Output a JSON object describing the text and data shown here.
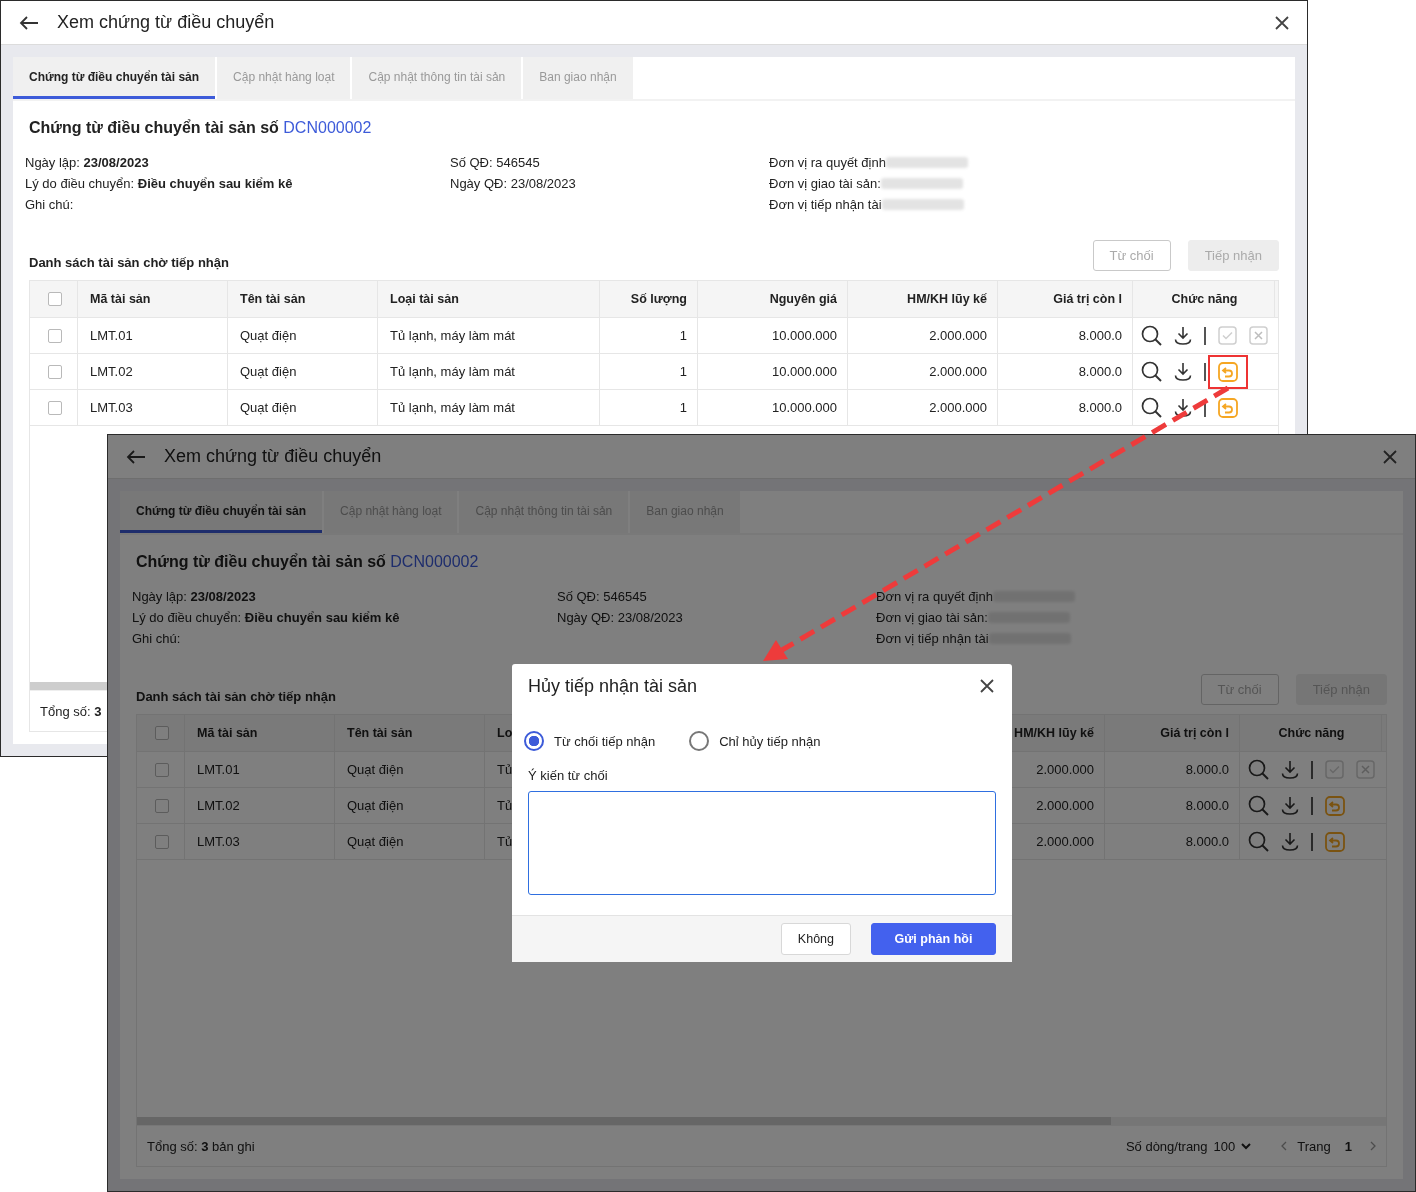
{
  "windows": [
    {
      "title": "Xem chứng từ điều chuyển",
      "dimmed": false,
      "tabs": [
        {
          "label": "Chứng từ điều chuyển tài sản",
          "selected": true
        },
        {
          "label": "Cập nhật hàng loạt",
          "selected": false
        },
        {
          "label": "Cập nhật thông tin tài sản",
          "selected": false
        },
        {
          "label": "Ban giao nhận",
          "selected": false
        }
      ],
      "heading": {
        "text": "Chứng từ điều chuyển tài sản số",
        "number": "DCN000002"
      },
      "details": [
        [
          {
            "label": "Ngày lập:",
            "value": "23/08/2023",
            "bold": true
          },
          {
            "label": "Lý do điều chuyển:",
            "value": "Điều chuyển sau kiểm kê",
            "bold": true
          },
          {
            "label": "Ghi chú:"
          }
        ],
        [
          {
            "label": "Số QĐ:",
            "value": "546545",
            "bold": false
          },
          {
            "label": "Ngày QĐ:",
            "value": "23/08/2023",
            "bold": false
          }
        ],
        [
          {
            "label": "Đơn vị ra quyết định",
            "blurred": true
          },
          {
            "label": "Đơn vị giao tài sản:",
            "blurred": true
          },
          {
            "label": "Đơn vị tiếp nhận tài",
            "blurred": true
          }
        ]
      ],
      "list_title": "Danh sách tài sản chờ tiếp nhận",
      "buttons": [
        {
          "label": "Từ chối",
          "kind": "outline",
          "disabled": true
        },
        {
          "label": "Tiếp nhận",
          "kind": "filled",
          "disabled": true
        }
      ],
      "table": {
        "select_all_checked": false,
        "columns": {
          "code": "Mã tài sản",
          "name": "Tên tài sản",
          "type": "Loại tài sản",
          "quantity": "Số lượng",
          "cost": "Nguyên giá",
          "depreciation": "HM/KH lũy kế",
          "remaining": "Giá trị còn l",
          "actions": "Chức năng"
        },
        "rows": [
          {
            "checked": false,
            "highlighted": false,
            "cells": {
              "code": "LMT.01",
              "name": "Quạt điện",
              "type": "Tủ lạnh, máy làm mát",
              "quantity": "1",
              "cost": "10.000.000",
              "depreciation": "2.000.000",
              "remaining": "8.000.0"
            },
            "actions": [
              {
                "kind": "search"
              },
              {
                "kind": "download"
              },
              {
                "kind": "accept"
              },
              {
                "kind": "reject"
              }
            ]
          },
          {
            "checked": false,
            "highlighted": true,
            "cells": {
              "code": "LMT.02",
              "name": "Quạt điện",
              "type": "Tủ lạnh, máy làm mát",
              "quantity": "1",
              "cost": "10.000.000",
              "depreciation": "2.000.000",
              "remaining": "8.000.0"
            },
            "actions": [
              {
                "kind": "search"
              },
              {
                "kind": "download"
              },
              {
                "kind": "return"
              }
            ]
          },
          {
            "checked": false,
            "highlighted": false,
            "cells": {
              "code": "LMT.03",
              "name": "Quạt điện",
              "type": "Tủ lạnh, máy làm mát",
              "quantity": "1",
              "cost": "10.000.000",
              "depreciation": "2.000.000",
              "remaining": "8.000.0"
            },
            "actions": [
              {
                "kind": "search"
              },
              {
                "kind": "download"
              },
              {
                "kind": "return"
              }
            ]
          }
        ]
      },
      "footer": {
        "total": "Tổng số: **3**"
      }
    },
    {
      "title": "Xem chứng từ điều chuyển",
      "dimmed": true,
      "tabs": [
        {
          "label": "Chứng từ điều chuyển tài sản",
          "selected": true
        },
        {
          "label": "Cập nhật hàng loạt",
          "selected": false
        },
        {
          "label": "Cập nhật thông tin tài sản",
          "selected": false
        },
        {
          "label": "Ban giao nhận",
          "selected": false
        }
      ],
      "heading": {
        "text": "Chứng từ điều chuyển tài sản số",
        "number": "DCN000002"
      },
      "details": [
        [
          {
            "label": "Ngày lập:",
            "value": "23/08/2023",
            "bold": true
          },
          {
            "label": "Lý do điều chuyển:",
            "value": "Điều chuyển sau kiểm kê",
            "bold": true
          },
          {
            "label": "Ghi chú:"
          }
        ],
        [
          {
            "label": "Số QĐ:",
            "value": "546545",
            "bold": false
          },
          {
            "label": "Ngày QĐ:",
            "value": "23/08/2023",
            "bold": false
          }
        ],
        [
          {
            "label": "Đơn vị ra quyết định",
            "blurred": true
          },
          {
            "label": "Đơn vị giao tài sản:",
            "blurred": true
          },
          {
            "label": "Đơn vị tiếp nhận tài",
            "blurred": true
          }
        ]
      ],
      "list_title": "Danh sách tài sản chờ tiếp nhận",
      "buttons": [
        {
          "label": "Từ chối",
          "kind": "outline",
          "disabled": true
        },
        {
          "label": "Tiếp nhận",
          "kind": "filled",
          "disabled": true
        }
      ],
      "table": {
        "select_all_checked": false,
        "columns": {
          "code": "Mã tài sản",
          "name": "Tên tài sản",
          "type": "Lo",
          "depreciation": "HM/KH lũy kế",
          "remaining": "Giá trị còn l",
          "actions": "Chức năng"
        },
        "rows": [
          {
            "checked": false,
            "highlighted": false,
            "cells": {
              "code": "LMT.01",
              "name": "Quạt điện",
              "type": "Tủ",
              "depreciation": "2.000.000",
              "remaining": "8.000.0"
            },
            "actions": [
              {
                "kind": "search"
              },
              {
                "kind": "download"
              },
              {
                "kind": "accept"
              },
              {
                "kind": "reject"
              }
            ]
          },
          {
            "checked": false,
            "highlighted": false,
            "cells": {
              "code": "LMT.02",
              "name": "Quạt điện",
              "type": "Tủ",
              "depreciation": "2.000.000",
              "remaining": "8.000.0"
            },
            "actions": [
              {
                "kind": "search"
              },
              {
                "kind": "download"
              },
              {
                "kind": "return"
              }
            ]
          },
          {
            "checked": false,
            "highlighted": false,
            "cells": {
              "code": "LMT.03",
              "name": "Quạt điện",
              "type": "Tủ",
              "depreciation": "2.000.000",
              "remaining": "8.000.0"
            },
            "actions": [
              {
                "kind": "search"
              },
              {
                "kind": "download"
              },
              {
                "kind": "return"
              }
            ]
          }
        ]
      },
      "footer": {
        "total": "Tổng số: **3** bản ghi",
        "page_size_label": "Số dòng/trang",
        "page_size": "100",
        "page_label": "Trang",
        "page": "1"
      },
      "dialog": {
        "title": "Hủy tiếp nhận tài sản",
        "options": [
          {
            "label": "Từ chối tiếp nhận",
            "selected": true
          },
          {
            "label": "Chỉ hủy tiếp nhận",
            "selected": false
          }
        ],
        "comment_label": "Ý kiến từ chối",
        "buttons": [
          {
            "label": "Không",
            "kind": "secondary"
          },
          {
            "label": "Gửi phản hồi",
            "kind": "primary"
          }
        ]
      }
    }
  ]
}
